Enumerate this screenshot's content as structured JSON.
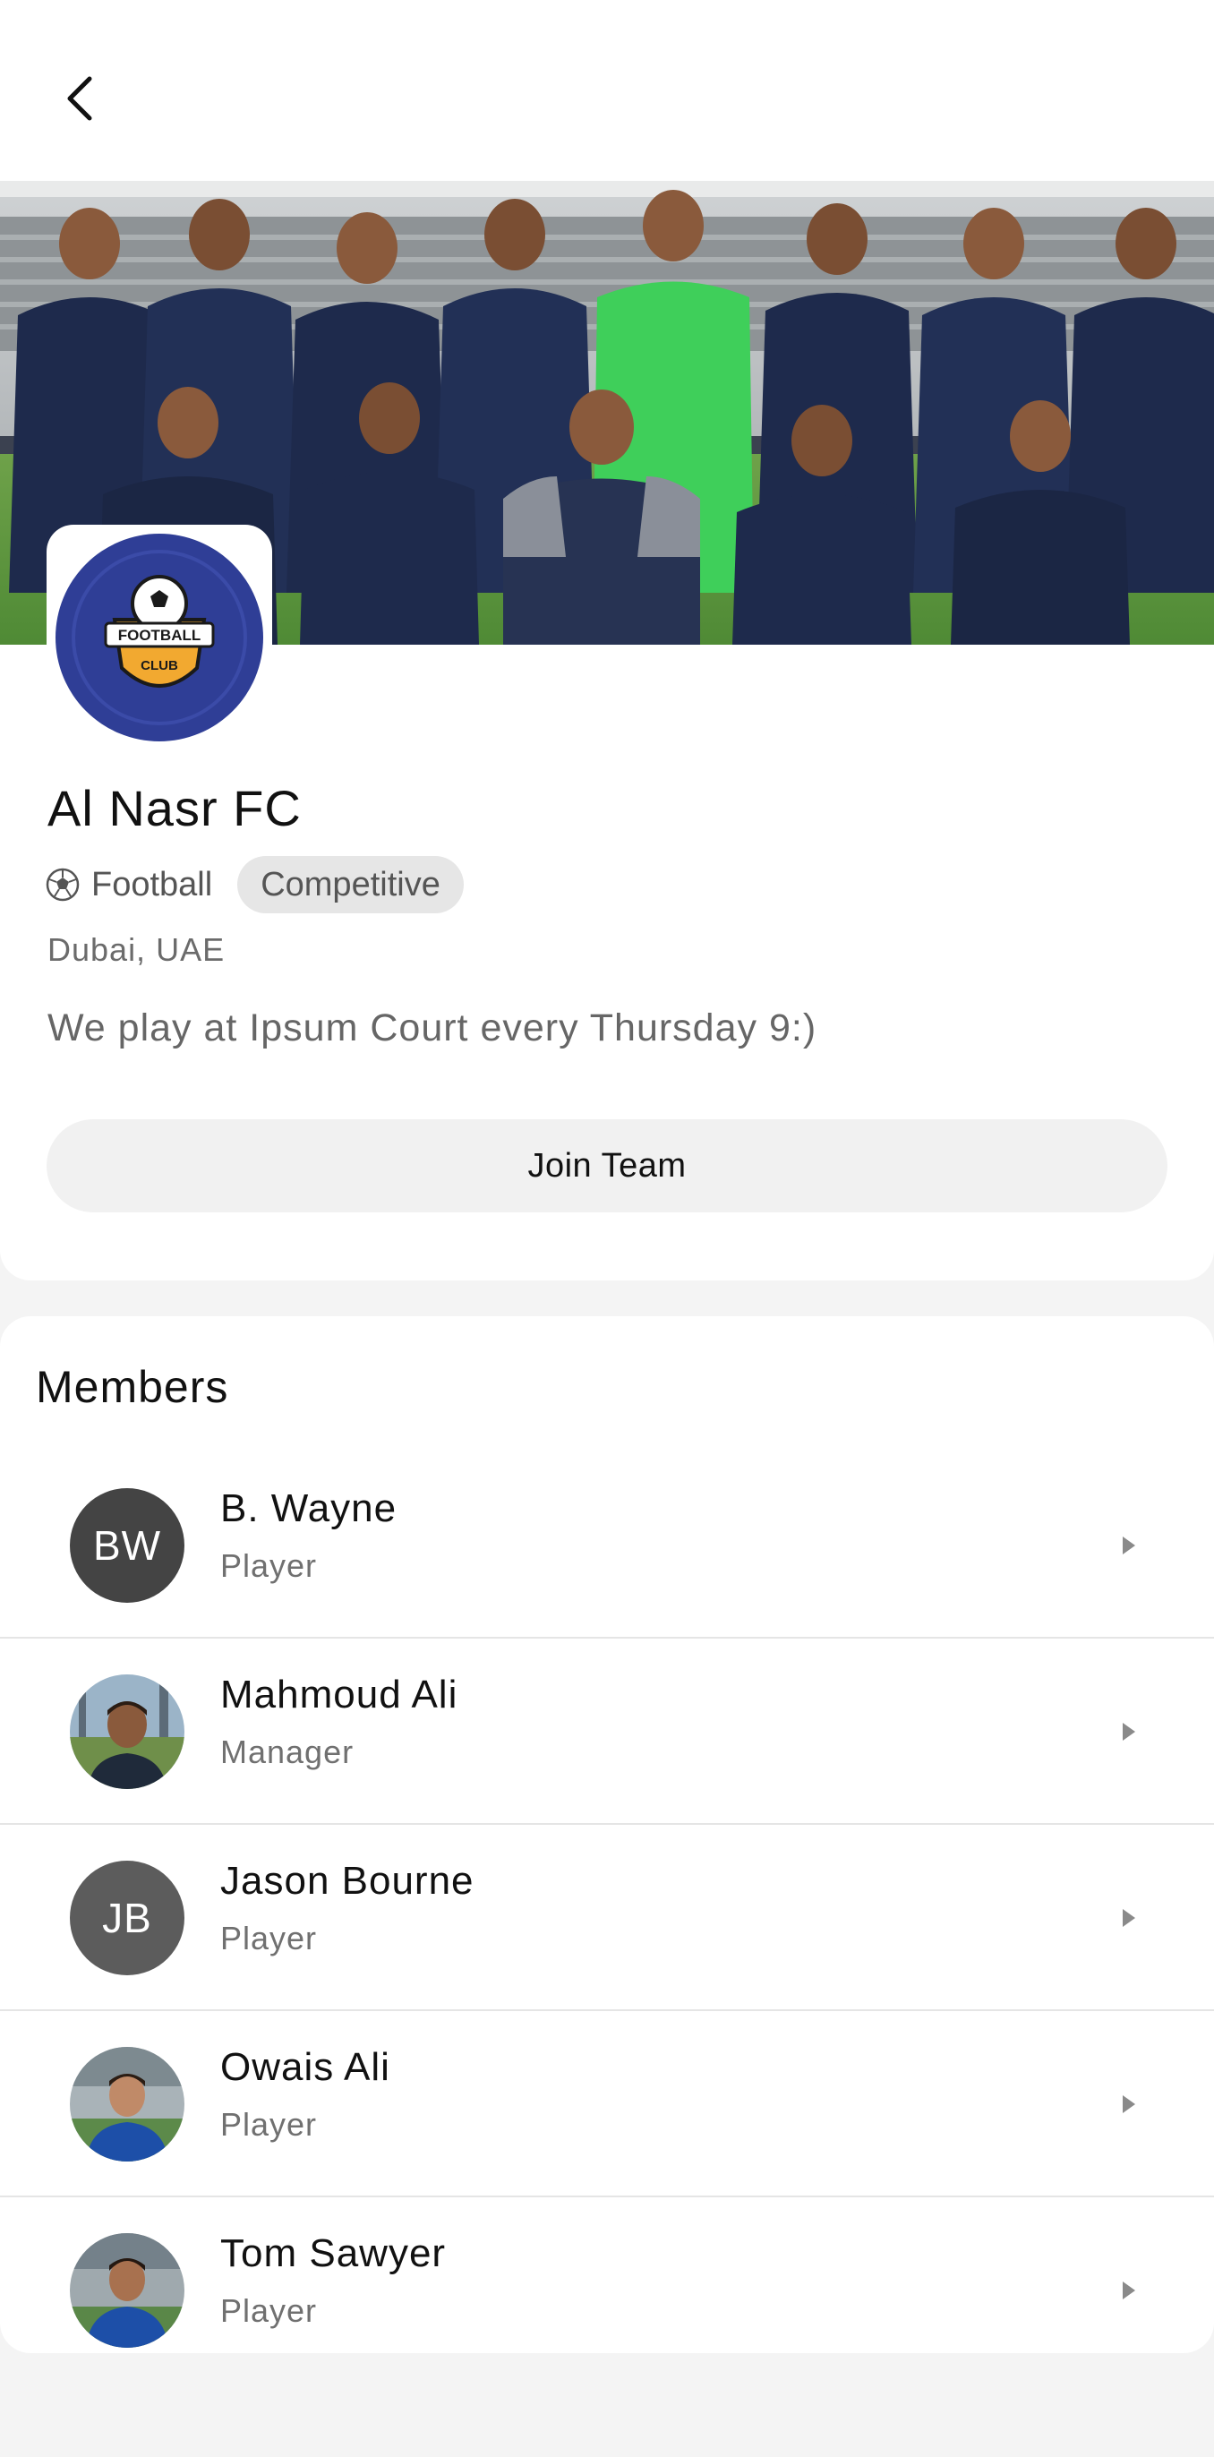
{
  "header": {
    "back_icon": "chevron-left-icon"
  },
  "team": {
    "name": "Al Nasr FC",
    "logo_text_top": "FOOTBALL",
    "logo_text_bottom": "CLUB",
    "sport": "Football",
    "sport_icon": "soccer-ball-icon",
    "level": "Competitive",
    "location": "Dubai, UAE",
    "description": "We play at Ipsum Court every Thursday 9:)",
    "join_label": "Join Team",
    "colors": {
      "logo_bg": "#2f3e96",
      "kit_navy": "#1e2a4c",
      "keeper_green": "#3fcf5a"
    }
  },
  "members": {
    "title": "Members",
    "items": [
      {
        "name": "B. Wayne",
        "role": "Player",
        "initials": "BW",
        "avatar": "initials",
        "color": "#444444"
      },
      {
        "name": "Mahmoud Ali",
        "role": "Manager",
        "initials": "",
        "avatar": "photo",
        "color": "#1f2a3a"
      },
      {
        "name": "Jason Bourne",
        "role": "Player",
        "initials": "JB",
        "avatar": "initials",
        "color": "#5c5c5c"
      },
      {
        "name": "Owais Ali",
        "role": "Player",
        "initials": "",
        "avatar": "photo",
        "color": "#1d4fa8"
      },
      {
        "name": "Tom Sawyer",
        "role": "Player",
        "initials": "",
        "avatar": "photo",
        "color": "#1d4fa8"
      }
    ]
  }
}
